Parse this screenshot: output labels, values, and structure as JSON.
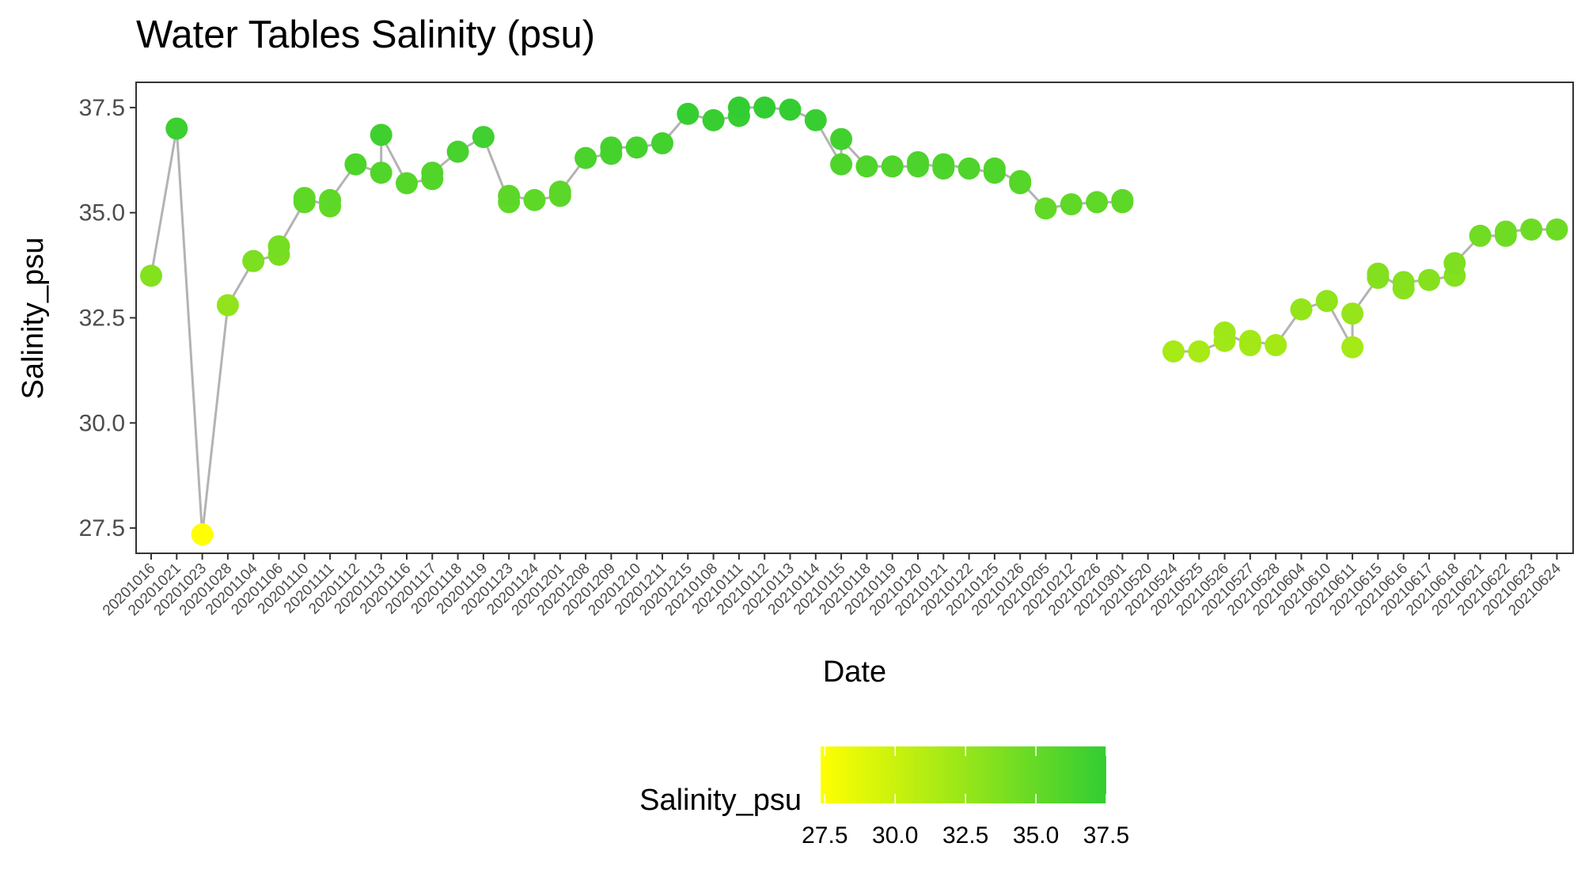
{
  "chart_data": {
    "type": "scatter",
    "title": "Water Tables Salinity (psu)",
    "xlabel": "Date",
    "ylabel": "Salinity_psu",
    "ylim": [
      26.9,
      38.1
    ],
    "yticks": [
      27.5,
      30.0,
      32.5,
      35.0,
      37.5
    ],
    "ytick_labels": [
      "27.5",
      "30.0",
      "32.5",
      "35.0",
      "37.5"
    ],
    "grid": false,
    "categories": [
      "20201016",
      "20201021",
      "20201023",
      "20201028",
      "20201104",
      "20201106",
      "20201110",
      "20201111",
      "20201112",
      "20201113",
      "20201116",
      "20201117",
      "20201118",
      "20201119",
      "20201123",
      "20201124",
      "20201201",
      "20201208",
      "20201209",
      "20201210",
      "20201211",
      "20201215",
      "20210108",
      "20210111",
      "20210112",
      "20210113",
      "20210114",
      "20210115",
      "20210118",
      "20210119",
      "20210120",
      "20210121",
      "20210122",
      "20210125",
      "20210126",
      "20210205",
      "20210212",
      "20210226",
      "20210301",
      "20210520",
      "20210524",
      "20210525",
      "20210526",
      "20210527",
      "20210528",
      "20210604",
      "20210610",
      "20210611",
      "20210615",
      "20210616",
      "20210617",
      "20210618",
      "20210621",
      "20210622",
      "20210623",
      "20210624"
    ],
    "series": [
      {
        "values": [
          [
            33.5
          ],
          [
            37.0
          ],
          [
            27.35
          ],
          [
            32.8
          ],
          [
            33.85
          ],
          [
            34.0,
            34.2
          ],
          [
            35.25,
            35.35
          ],
          [
            35.15,
            35.3
          ],
          [
            36.15
          ],
          [
            35.95,
            36.85
          ],
          [
            35.7
          ],
          [
            35.8,
            35.95
          ],
          [
            36.45
          ],
          [
            36.8
          ],
          [
            35.25,
            35.4
          ],
          [
            35.3
          ],
          [
            35.4,
            35.5
          ],
          [
            36.3
          ],
          [
            36.4,
            36.55
          ],
          [
            36.55
          ],
          [
            36.65
          ],
          [
            37.35
          ],
          [
            37.2
          ],
          [
            37.3,
            37.5
          ],
          [
            37.5
          ],
          [
            37.45
          ],
          [
            37.2
          ],
          [
            36.15,
            36.75
          ],
          [
            36.1
          ],
          [
            36.1
          ],
          [
            36.1,
            36.2
          ],
          [
            36.05,
            36.15
          ],
          [
            36.05
          ],
          [
            35.95,
            36.05
          ],
          [
            35.7,
            35.75
          ],
          [
            35.1
          ],
          [
            35.2
          ],
          [
            35.25
          ],
          [
            35.25,
            35.3
          ],
          [],
          [
            31.7
          ],
          [
            31.7
          ],
          [
            31.95,
            32.15
          ],
          [
            31.85,
            31.95
          ],
          [
            31.85
          ],
          [
            32.7
          ],
          [
            32.9
          ],
          [
            31.8,
            32.6
          ],
          [
            33.45,
            33.55
          ],
          [
            33.2,
            33.35
          ],
          [
            33.4
          ],
          [
            33.5,
            33.8
          ],
          [
            34.45
          ],
          [
            34.45,
            34.55
          ],
          [
            34.6
          ],
          [
            34.6
          ]
        ],
        "color_scale": "Salinity_psu"
      }
    ],
    "line_color": "#b3b3b3",
    "legend": {
      "title": "Salinity_psu",
      "position": "bottom",
      "ticks": [
        27.5,
        30.0,
        32.5,
        35.0,
        37.5
      ],
      "tick_labels": [
        "27.5",
        "30.0",
        "32.5",
        "35.0",
        "37.5"
      ],
      "low_color": "#ffff00",
      "high_color": "#32cd32",
      "domain": [
        27.35,
        37.5
      ]
    }
  }
}
